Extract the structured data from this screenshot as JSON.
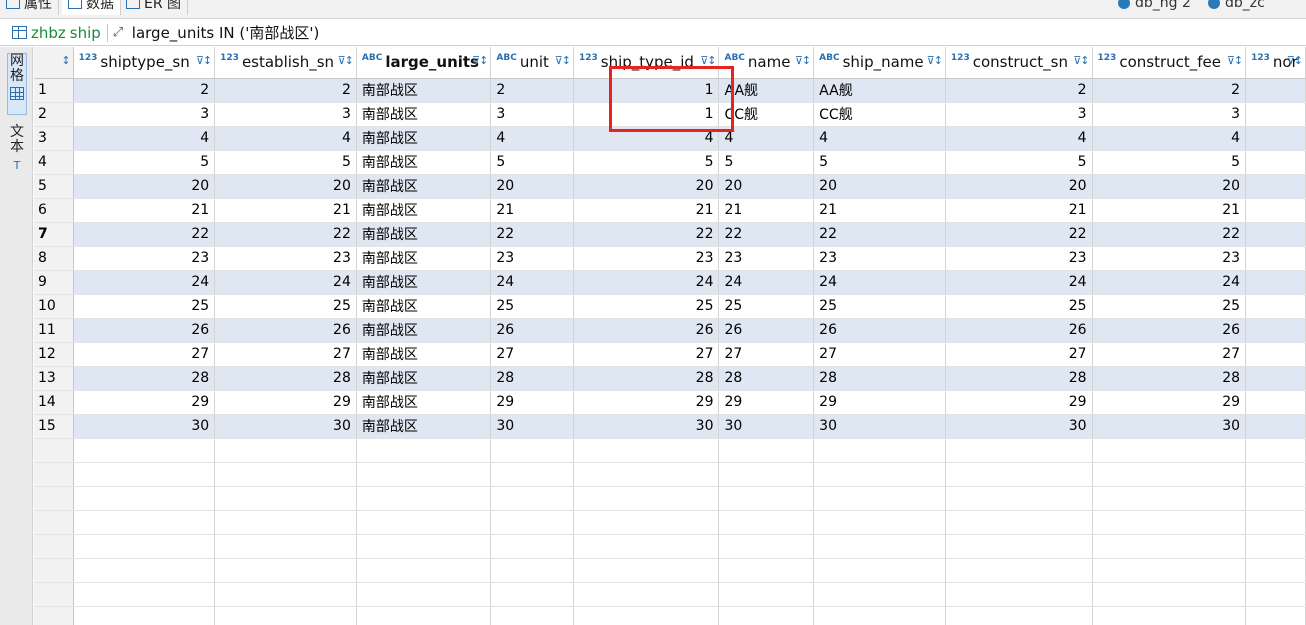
{
  "tabs": [
    {
      "label": "属性"
    },
    {
      "label": "数据"
    },
    {
      "label": "ER 图"
    }
  ],
  "connections": [
    {
      "label": "db_ng 2"
    },
    {
      "label": "db_zc"
    }
  ],
  "filter": {
    "table_schema": "zhbz",
    "table_name": "ship",
    "expression": "large_units IN ('南部战区')"
  },
  "side_tabs": [
    {
      "label": "网格"
    },
    {
      "label": "文本"
    }
  ],
  "columns": [
    {
      "name": "shiptype_sn",
      "type": "123"
    },
    {
      "name": "establish_sn",
      "type": "123"
    },
    {
      "name": "large_units",
      "type": "ABC"
    },
    {
      "name": "unit",
      "type": "ABC"
    },
    {
      "name": "ship_type_id",
      "type": "123"
    },
    {
      "name": "name",
      "type": "ABC"
    },
    {
      "name": "ship_name",
      "type": "ABC"
    },
    {
      "name": "construct_sn",
      "type": "123"
    },
    {
      "name": "construct_fee",
      "type": "123"
    },
    {
      "name": "nor",
      "type": "123"
    }
  ],
  "current_row": 7,
  "rows": [
    {
      "n": "1",
      "c": [
        "2",
        "2",
        "南部战区",
        "2",
        "1",
        "AA舰",
        "AA舰",
        "2",
        "2",
        ""
      ]
    },
    {
      "n": "2",
      "c": [
        "3",
        "3",
        "南部战区",
        "3",
        "1",
        "CC舰",
        "CC舰",
        "3",
        "3",
        ""
      ]
    },
    {
      "n": "3",
      "c": [
        "4",
        "4",
        "南部战区",
        "4",
        "4",
        "4",
        "4",
        "4",
        "4",
        ""
      ]
    },
    {
      "n": "4",
      "c": [
        "5",
        "5",
        "南部战区",
        "5",
        "5",
        "5",
        "5",
        "5",
        "5",
        ""
      ]
    },
    {
      "n": "5",
      "c": [
        "20",
        "20",
        "南部战区",
        "20",
        "20",
        "20",
        "20",
        "20",
        "20",
        ""
      ]
    },
    {
      "n": "6",
      "c": [
        "21",
        "21",
        "南部战区",
        "21",
        "21",
        "21",
        "21",
        "21",
        "21",
        ""
      ]
    },
    {
      "n": "7",
      "c": [
        "22",
        "22",
        "南部战区",
        "22",
        "22",
        "22",
        "22",
        "22",
        "22",
        ""
      ]
    },
    {
      "n": "8",
      "c": [
        "23",
        "23",
        "南部战区",
        "23",
        "23",
        "23",
        "23",
        "23",
        "23",
        ""
      ]
    },
    {
      "n": "9",
      "c": [
        "24",
        "24",
        "南部战区",
        "24",
        "24",
        "24",
        "24",
        "24",
        "24",
        ""
      ]
    },
    {
      "n": "10",
      "c": [
        "25",
        "25",
        "南部战区",
        "25",
        "25",
        "25",
        "25",
        "25",
        "25",
        ""
      ]
    },
    {
      "n": "11",
      "c": [
        "26",
        "26",
        "南部战区",
        "26",
        "26",
        "26",
        "26",
        "26",
        "26",
        ""
      ]
    },
    {
      "n": "12",
      "c": [
        "27",
        "27",
        "南部战区",
        "27",
        "27",
        "27",
        "27",
        "27",
        "27",
        ""
      ]
    },
    {
      "n": "13",
      "c": [
        "28",
        "28",
        "南部战区",
        "28",
        "28",
        "28",
        "28",
        "28",
        "28",
        ""
      ]
    },
    {
      "n": "14",
      "c": [
        "29",
        "29",
        "南部战区",
        "29",
        "29",
        "29",
        "29",
        "29",
        "29",
        ""
      ]
    },
    {
      "n": "15",
      "c": [
        "30",
        "30",
        "南部战区",
        "30",
        "30",
        "30",
        "30",
        "30",
        "30",
        ""
      ]
    }
  ],
  "colors": {
    "highlight": "#e8231f",
    "row_alt": "#dfe7f2",
    "accent": "#2a6fb0"
  }
}
